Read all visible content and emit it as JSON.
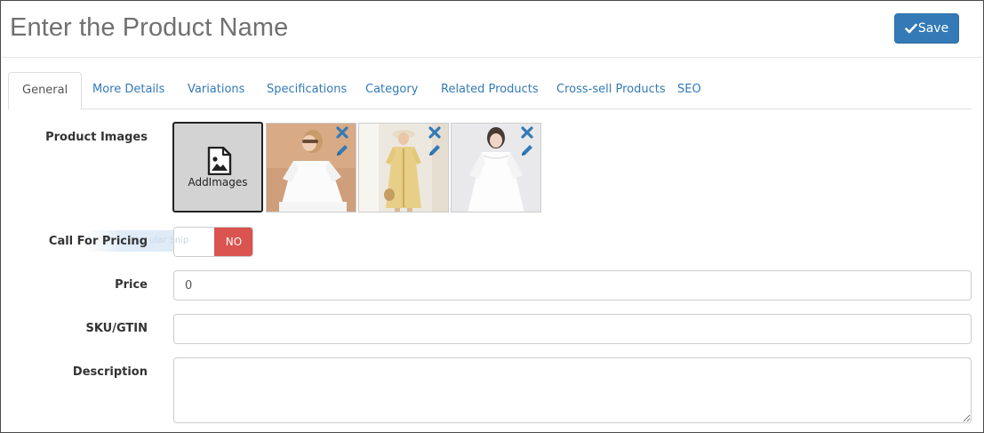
{
  "header": {
    "title": "Enter the Product Name",
    "save_label": "Save"
  },
  "tabs": [
    {
      "label": "General",
      "active": true
    },
    {
      "label": "More Details"
    },
    {
      "label": "Variations"
    },
    {
      "label": "Specifications"
    },
    {
      "label": "Category"
    },
    {
      "label": "Related Products"
    },
    {
      "label": "Cross-sell Products"
    },
    {
      "label": "SEO"
    }
  ],
  "form": {
    "product_images": {
      "label": "Product Images",
      "add_label": "AddImages",
      "images": [
        {
          "icons": [
            "remove-icon",
            "edit-icon"
          ]
        },
        {
          "icons": [
            "remove-icon",
            "edit-icon"
          ]
        },
        {
          "icons": [
            "remove-icon",
            "edit-icon"
          ]
        }
      ]
    },
    "call_for_pricing": {
      "label": "Call For Pricing",
      "value": "NO",
      "overlay_text": "ular Snip"
    },
    "price": {
      "label": "Price",
      "value": "0"
    },
    "sku": {
      "label": "SKU/GTIN",
      "value": ""
    },
    "description": {
      "label": "Description",
      "value": ""
    }
  },
  "colors": {
    "primary": "#337ab7",
    "danger": "#d9534f",
    "title": "#707070",
    "link": "#337ab7"
  }
}
